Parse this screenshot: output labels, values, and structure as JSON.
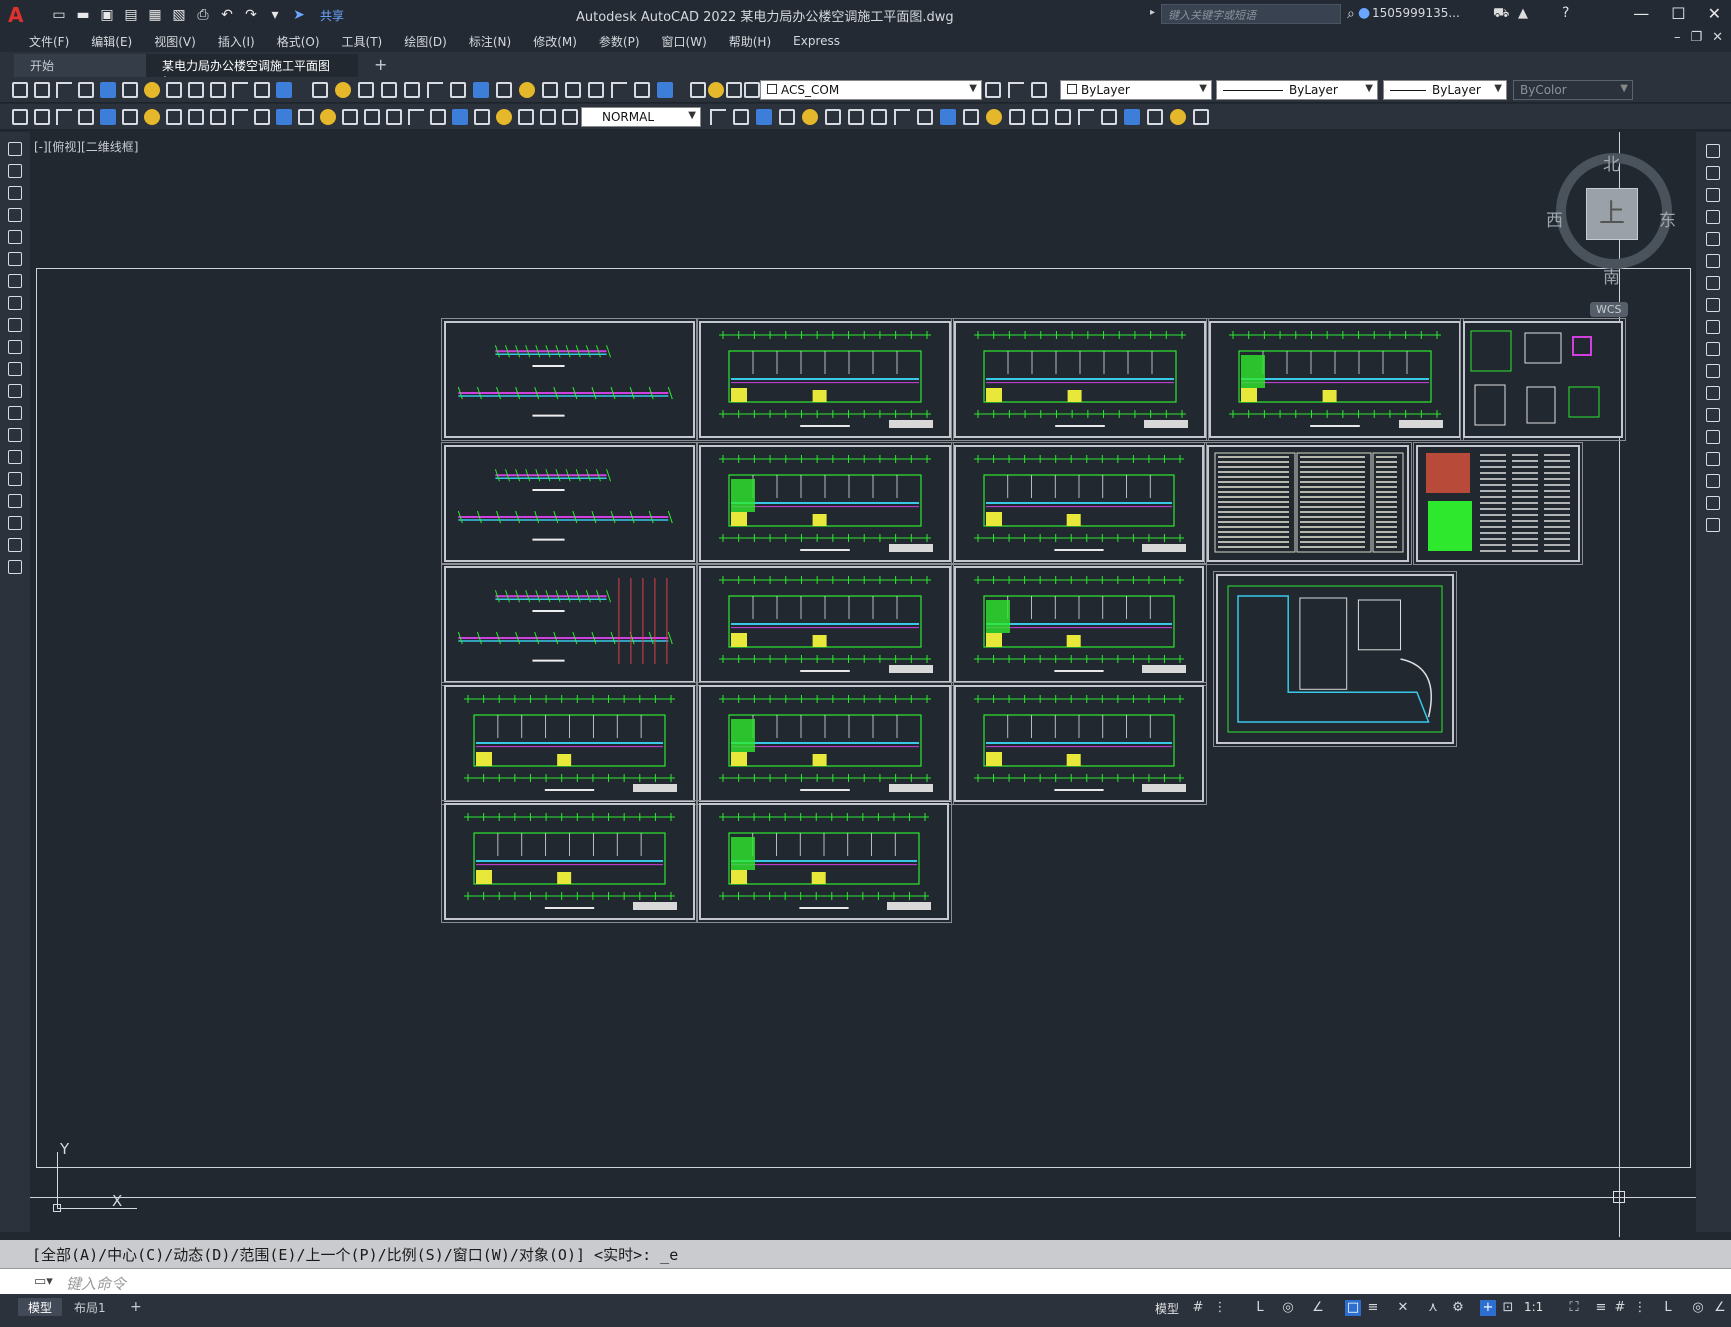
{
  "app": {
    "logo": "A",
    "title": "Autodesk AutoCAD 2022    某电力局办公楼空调施工平面图.dwg",
    "share_label": "共享",
    "search_placeholder": "键入关键字或短语",
    "user": "1505999135...",
    "window_controls": [
      "minimize-icon",
      "restore-icon",
      "close-icon"
    ]
  },
  "menu": [
    "文件(F)",
    "编辑(E)",
    "视图(V)",
    "插入(I)",
    "格式(O)",
    "工具(T)",
    "绘图(D)",
    "标注(N)",
    "修改(M)",
    "参数(P)",
    "窗口(W)",
    "帮助(H)",
    "Express"
  ],
  "file_tabs": {
    "start": "开始",
    "active": "某电力局办公楼空调施工平面图*",
    "close": "✕",
    "add": "+"
  },
  "toolbar": {
    "layer": "ACS_COM",
    "color": "ByLayer",
    "linetype": "ByLayer",
    "lineweight": "ByLayer",
    "plotstyle": "ByColor",
    "dimstyle": "NORMAL"
  },
  "viewport": {
    "label": "[-][俯视][二维线框]",
    "viewcube": {
      "north": "北",
      "south": "南",
      "east": "东",
      "west": "西",
      "face": "上",
      "wcs": "WCS"
    },
    "ucs": {
      "x": "X",
      "y": "Y"
    }
  },
  "colors": {
    "background": "#212830",
    "green": "#2ee82e",
    "cyan": "#38c8e8",
    "magenta": "#d040e0",
    "yellow": "#e8e83a"
  },
  "command": {
    "history": "[全部(A)/中心(C)/动态(D)/范围(E)/上一个(P)/比例(S)/窗口(W)/对象(O)] <实时>: _e",
    "placeholder": "键入命令"
  },
  "status": {
    "model_tab": "模型",
    "layout_tab": "布局1",
    "add": "+",
    "model_label": "模型",
    "scale": "1:1"
  }
}
